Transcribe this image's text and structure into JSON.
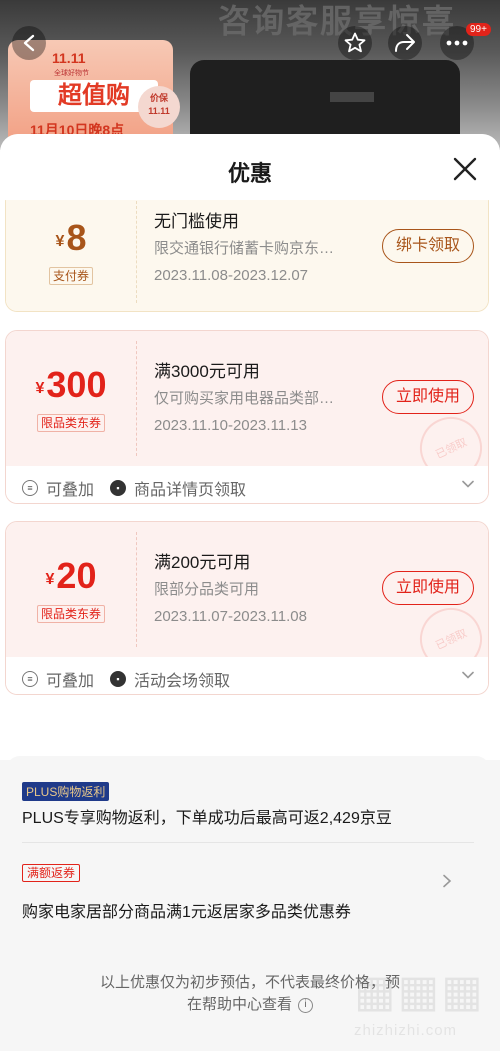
{
  "background": {
    "banner_text": "咨询客服享惊喜",
    "promo": {
      "logo": "11.11",
      "festival": "全球好物节",
      "headline": "超值购",
      "date": "11月10日晚8点",
      "tag_line1": "价保",
      "tag_line2": "11.11"
    },
    "nav": {
      "badge": "99+"
    }
  },
  "sheet": {
    "title": "优惠",
    "coupons": [
      {
        "currency": "¥",
        "amount": "8",
        "tag": "支付券",
        "title": "无门槛使用",
        "desc": "限交通银行储蓄卡购京东…",
        "date": "2023.11.08-2023.12.07",
        "button": "绑卡领取"
      },
      {
        "currency": "¥",
        "amount": "300",
        "tag": "限品类东券",
        "title": "满3000元可用",
        "desc": "仅可购买家用电器品类部…",
        "date": "2023.11.10-2023.11.13",
        "button": "立即使用",
        "stamp": "已领取",
        "footer": {
          "stackable": "可叠加",
          "source": "商品详情页领取"
        }
      },
      {
        "currency": "¥",
        "amount": "20",
        "tag": "限品类东券",
        "title": "满200元可用",
        "desc": "限部分品类可用",
        "date": "2023.11.07-2023.11.08",
        "button": "立即使用",
        "stamp": "已领取",
        "footer": {
          "stackable": "可叠加",
          "source": "活动会场领取"
        }
      }
    ],
    "plus": {
      "tag": "PLUS购物返利",
      "text": "PLUS专享购物返利，下单成功后最高可返2,429京豆"
    },
    "return_coupon": {
      "tag": "满额返券",
      "text": "购家电家居部分商品满1元返居家多品类优惠券"
    },
    "disclaimer": {
      "line1": "以上优惠仅为初步预估，不代表最终价格，预",
      "line2": "在帮助中心查看"
    }
  },
  "watermark": {
    "url": "zhizhizhi.com"
  }
}
